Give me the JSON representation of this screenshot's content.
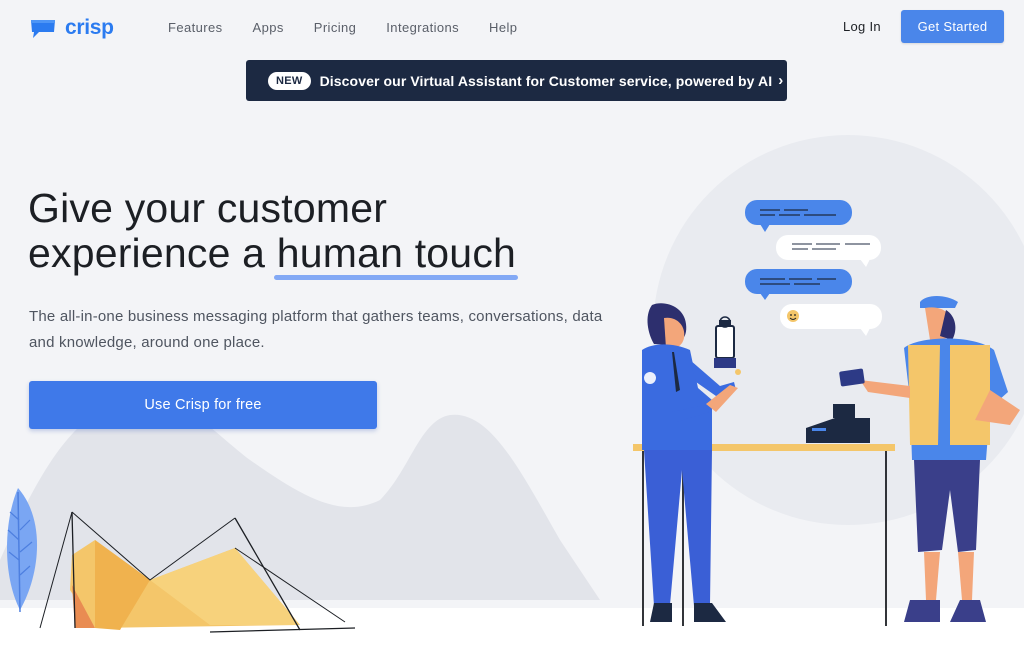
{
  "brand": {
    "name": "crisp",
    "color": "#2b7bf0"
  },
  "nav": {
    "items": [
      "Features",
      "Apps",
      "Pricing",
      "Integrations",
      "Help"
    ],
    "login": "Log In",
    "get_started": "Get Started"
  },
  "announcement": {
    "badge": "NEW",
    "text": "Discover our Virtual Assistant for Customer service, powered by AI",
    "chevron_icon": "chevron-right-icon"
  },
  "hero": {
    "title_line1": "Give your customer",
    "title_line2_prefix": "experience a ",
    "title_line2_highlight": "human touch",
    "subtitle": "The all-in-one business messaging platform that gathers teams, conversations, data and knowledge, around one place.",
    "cta": "Use Crisp for free"
  },
  "colors": {
    "primary": "#3f79e9",
    "announcement_bg": "#1c2942",
    "background": "#f3f4f7"
  }
}
